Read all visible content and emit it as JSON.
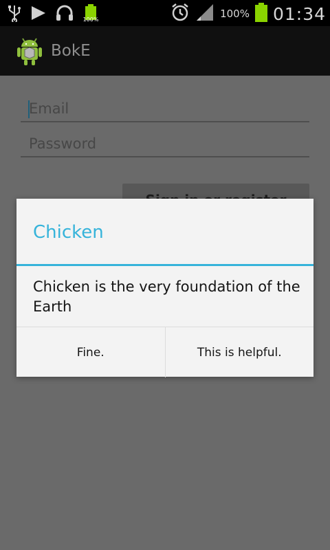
{
  "status_bar": {
    "left_icons": [
      "usb-icon",
      "play-store-icon",
      "headset-icon",
      "battery-small-icon"
    ],
    "small_battery_label": "100%",
    "battery_percent": "100%",
    "time": "01:34",
    "battery_color": "#8ad300"
  },
  "action_bar": {
    "title": "BokE"
  },
  "login": {
    "email_placeholder": "Email",
    "password_placeholder": "Password",
    "sign_in_label": "Sign in or register"
  },
  "dialog": {
    "title": "Chicken",
    "message": "Chicken is the very foundation of the Earth",
    "buttons": [
      "Fine.",
      "This is helpful."
    ],
    "accent_color": "#35b3da"
  }
}
